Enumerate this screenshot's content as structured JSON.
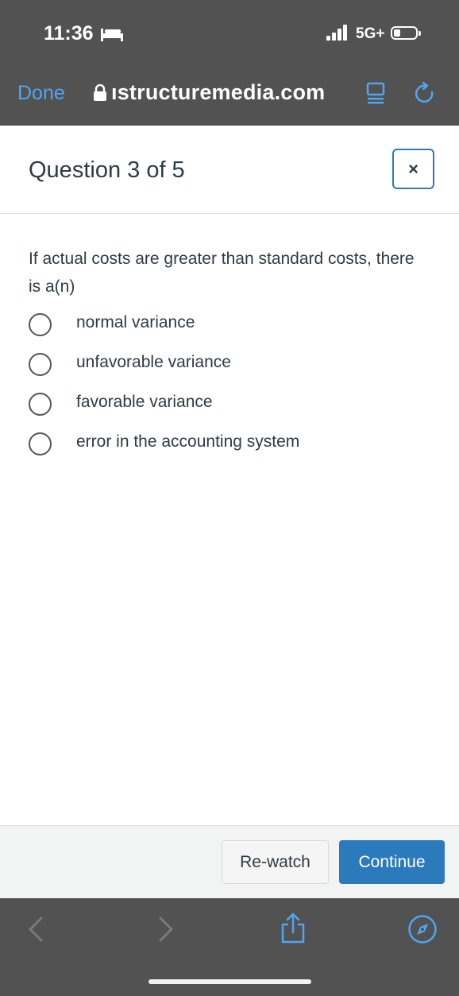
{
  "status_bar": {
    "time": "11:36",
    "network": "5G+",
    "icons": [
      "bed-icon",
      "signal-icon",
      "battery-icon"
    ]
  },
  "browser": {
    "done_label": "Done",
    "url": "ıstructuremedia.com",
    "icons": [
      "lock-icon",
      "reader-icon",
      "reload-icon"
    ]
  },
  "quiz": {
    "title": "Question 3 of 5",
    "close_label": "×",
    "prompt": "If actual costs are greater than standard costs, there is a(n)",
    "options": [
      {
        "label": "normal variance"
      },
      {
        "label": "unfavorable variance"
      },
      {
        "label": "favorable variance"
      },
      {
        "label": "error in the accounting system"
      }
    ]
  },
  "footer": {
    "rewatch_label": "Re-watch",
    "continue_label": "Continue"
  },
  "toolbar": {
    "icons": [
      "back-icon",
      "forward-icon",
      "share-icon",
      "compass-icon"
    ]
  },
  "colors": {
    "chrome": "#525252",
    "link": "#4ea6f2",
    "primary": "#2b7abc",
    "text": "#2d3b45",
    "footer_bg": "#f2f4f4"
  }
}
